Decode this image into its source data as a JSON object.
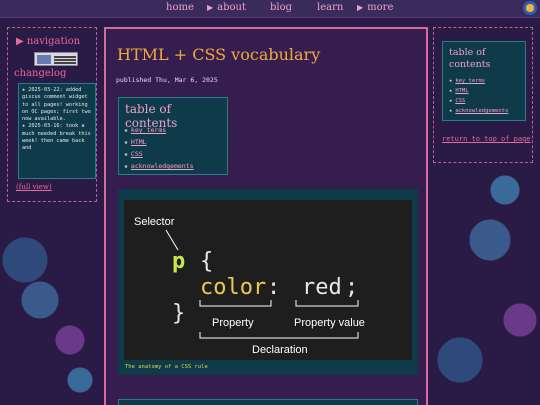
{
  "nav": {
    "items": [
      {
        "label": "home",
        "arrow": false
      },
      {
        "label": "about",
        "arrow": true
      },
      {
        "label": "blog",
        "arrow": false
      },
      {
        "label": "learn",
        "arrow": false
      },
      {
        "label": "more",
        "arrow": true
      }
    ],
    "arrow_glyph": "▶"
  },
  "left_sidebar": {
    "navigation_label": "▶ navigation",
    "changelog_title": "changelog",
    "changelog_entries": [
      "★ 2025-03-22: added giscus comment widget to all pages! working on OC pages; first two now available.",
      "★ 2025-03-16: took a much needed break this week! then came back and"
    ],
    "full_view_label": "(full view)"
  },
  "main": {
    "title": "HTML + CSS vocabulary",
    "published": "published Thu, Mar 6, 2025",
    "toc": {
      "title": "table of contents",
      "items": [
        "key terms",
        "HTML",
        "CSS",
        "acknowledgements"
      ]
    },
    "figure": {
      "selector_label": "Selector",
      "selector": "p",
      "open_brace": "{",
      "property": "color",
      "colon": ":",
      "value": "red",
      "semicolon": ";",
      "close_brace": "}",
      "property_label": "Property",
      "value_label": "Property value",
      "declaration_label": "Declaration",
      "caption": "The anatomy of a CSS rule"
    }
  },
  "right_sidebar": {
    "toc_title": "table of contents",
    "items": [
      "key terms",
      "HTML",
      "CSS",
      "acknowledgements"
    ],
    "back_to_top": "return to top of page"
  },
  "colors": {
    "accent_pink": "#e86a9a",
    "title_orange": "#f3a83a",
    "panel_teal": "#0f3a4a",
    "selector_green": "#c8e84a",
    "property_yellow": "#f3c84a"
  }
}
